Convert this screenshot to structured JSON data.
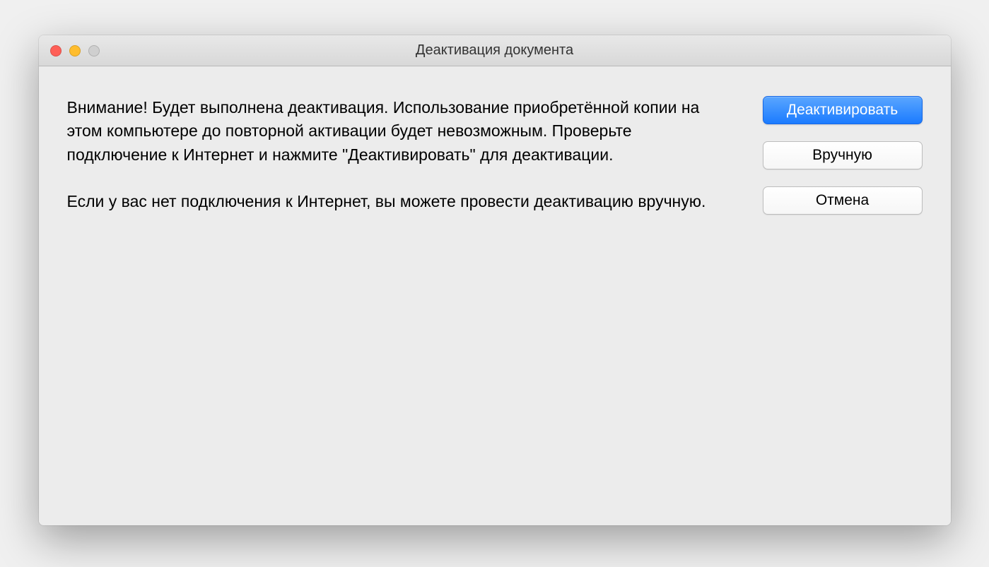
{
  "window": {
    "title": "Деактивация документа"
  },
  "message": {
    "paragraph1": "Внимание! Будет выполнена деактивация. Использование приобретённой копии на этом компьютере до повторной активации будет невозможным. Проверьте подключение к Интернет и нажмите \"Деактивировать\" для деактивации.",
    "paragraph2": "Если у вас нет подключения к Интернет, вы можете провести деактивацию вручную."
  },
  "buttons": {
    "deactivate": "Деактивировать",
    "manual": "Вручную",
    "cancel": "Отмена"
  }
}
